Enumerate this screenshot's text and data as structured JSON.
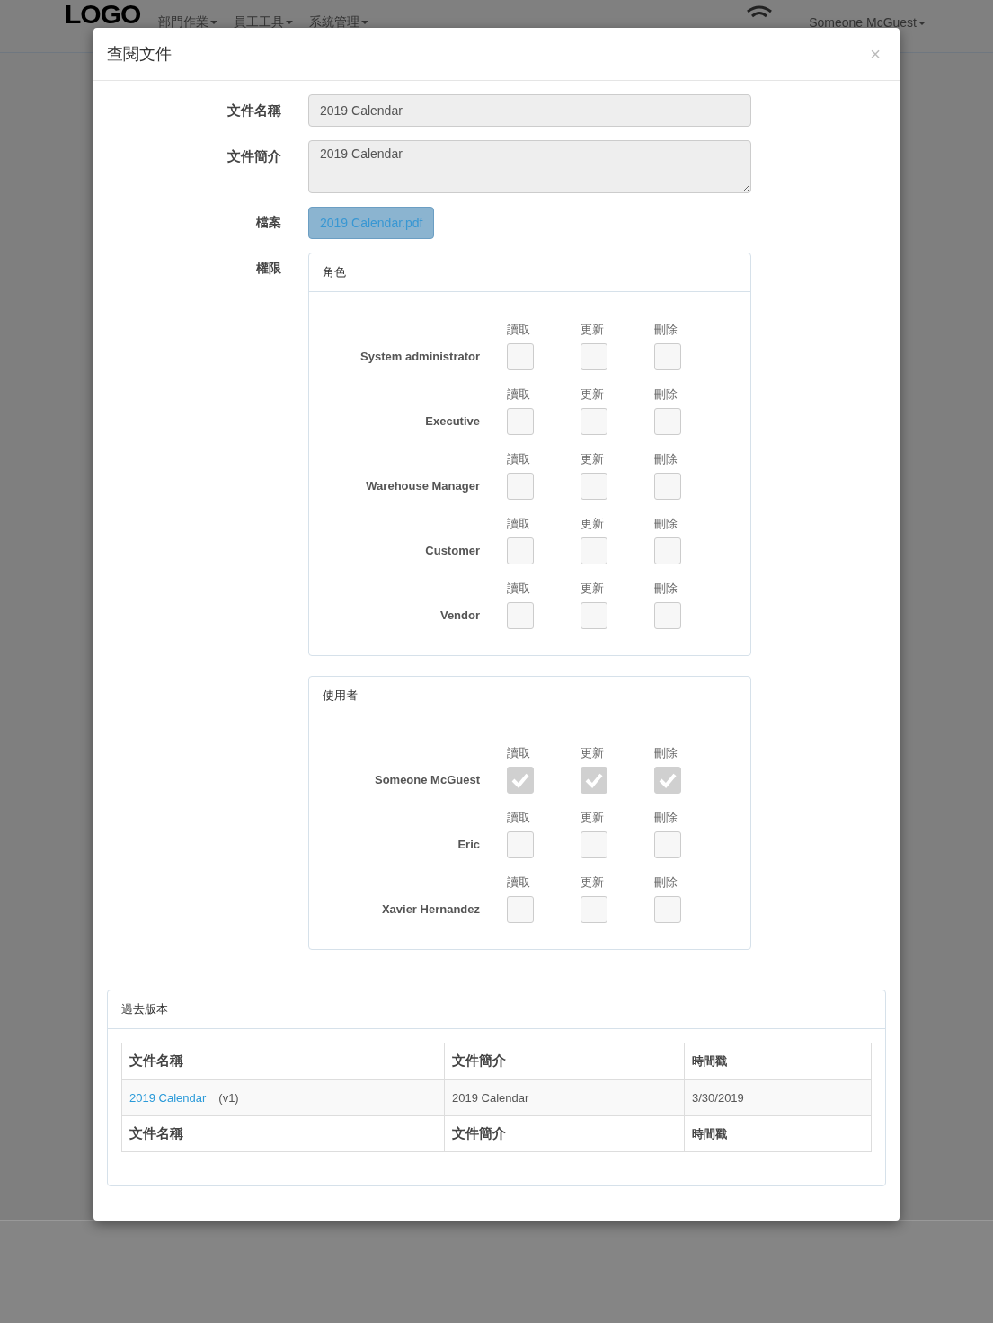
{
  "navbar": {
    "logo": "LOGO",
    "menus": [
      "部門作業",
      "員工工具",
      "系統管理"
    ],
    "user": "Someone McGuest"
  },
  "modal": {
    "title": "查閱文件",
    "close": "×",
    "fields": [
      {
        "label": "文件名稱",
        "kind": "input",
        "value": "2019 Calendar"
      },
      {
        "label": "文件簡介",
        "kind": "textarea",
        "value": "2019 Calendar"
      },
      {
        "label": "檔案",
        "kind": "file",
        "value": "2019 Calendar.pdf"
      }
    ],
    "permissions_label": "權限",
    "panels": [
      {
        "title": "角色",
        "rows": [
          {
            "name": "System administrator",
            "perms": [
              {
                "label": "讀取",
                "checked": false
              },
              {
                "label": "更新",
                "checked": false
              },
              {
                "label": "刪除",
                "checked": false
              }
            ]
          },
          {
            "name": "Executive",
            "perms": [
              {
                "label": "讀取",
                "checked": false
              },
              {
                "label": "更新",
                "checked": false
              },
              {
                "label": "刪除",
                "checked": false
              }
            ]
          },
          {
            "name": "Warehouse Manager",
            "perms": [
              {
                "label": "讀取",
                "checked": false
              },
              {
                "label": "更新",
                "checked": false
              },
              {
                "label": "刪除",
                "checked": false
              }
            ]
          },
          {
            "name": "Customer",
            "perms": [
              {
                "label": "讀取",
                "checked": false
              },
              {
                "label": "更新",
                "checked": false
              },
              {
                "label": "刪除",
                "checked": false
              }
            ]
          },
          {
            "name": "Vendor",
            "perms": [
              {
                "label": "讀取",
                "checked": false
              },
              {
                "label": "更新",
                "checked": false
              },
              {
                "label": "刪除",
                "checked": false
              }
            ]
          }
        ]
      },
      {
        "title": "使用者",
        "rows": [
          {
            "name": "Someone McGuest",
            "perms": [
              {
                "label": "讀取",
                "checked": true
              },
              {
                "label": "更新",
                "checked": true
              },
              {
                "label": "刪除",
                "checked": true
              }
            ]
          },
          {
            "name": "Eric",
            "perms": [
              {
                "label": "讀取",
                "checked": false
              },
              {
                "label": "更新",
                "checked": false
              },
              {
                "label": "刪除",
                "checked": false
              }
            ]
          },
          {
            "name": "Xavier Hernandez",
            "perms": [
              {
                "label": "讀取",
                "checked": false
              },
              {
                "label": "更新",
                "checked": false
              },
              {
                "label": "刪除",
                "checked": false
              }
            ]
          }
        ]
      }
    ],
    "history": {
      "title": "過去版本",
      "columns": [
        "文件名稱",
        "文件簡介",
        "時間戳"
      ],
      "rows": [
        {
          "name": "2019 Calendar",
          "version": "(v1)",
          "description": "2019 Calendar",
          "timestamp": "3/30/2019"
        }
      ],
      "footer": [
        "文件名稱",
        "文件簡介",
        "時間戳"
      ]
    }
  }
}
